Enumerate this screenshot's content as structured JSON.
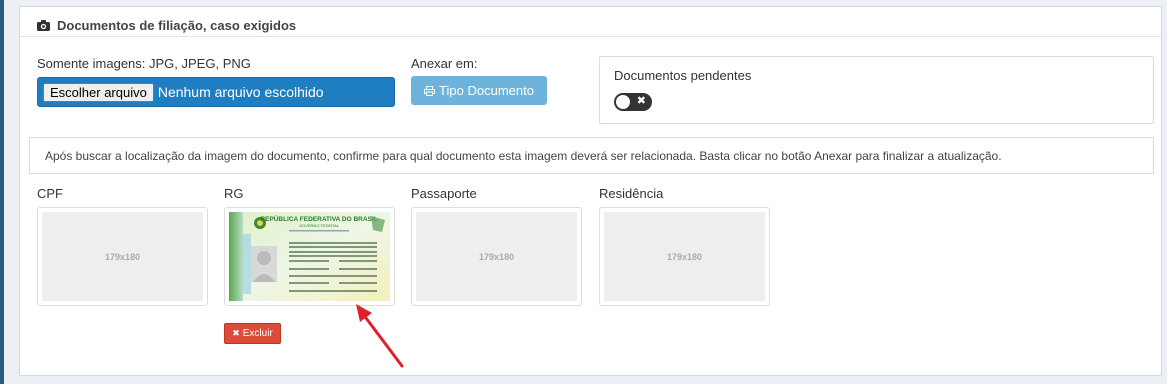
{
  "panel": {
    "title": "Documentos de filiação, caso exigidos",
    "icon": "camera-icon"
  },
  "upload": {
    "label": "Somente imagens: JPG, JPEG, PNG",
    "button_label": "Escolher arquivo",
    "status_text": "Nenhum arquivo escolhido"
  },
  "attach": {
    "label": "Anexar em:",
    "button_label": "Tipo Documento",
    "icon": "print-icon"
  },
  "pending": {
    "label": "Documentos pendentes",
    "toggle_on": false
  },
  "info": {
    "text": "Após buscar a localização da imagem do documento, confirme para qual documento esta imagem deverá ser relacionada. Basta clicar no botão Anexar para finalizar a atualização."
  },
  "documents": [
    {
      "label": "CPF",
      "placeholder": "179x180"
    },
    {
      "label": "RG",
      "image": "rg-document-image"
    },
    {
      "label": "Passaporte",
      "placeholder": "179x180"
    },
    {
      "label": "Residência",
      "placeholder": "179x180"
    }
  ],
  "delete": {
    "button_label": "Excluir"
  },
  "rg_card": {
    "line1": "REPÚBLICA FEDERATIVA DO BRASIL",
    "line2": "GOVERNO FEDERAL"
  },
  "colors": {
    "primary": "#1f7ec2",
    "info_button": "#6eb3db",
    "danger": "#dd4b39",
    "arrow": "#e0202a"
  }
}
